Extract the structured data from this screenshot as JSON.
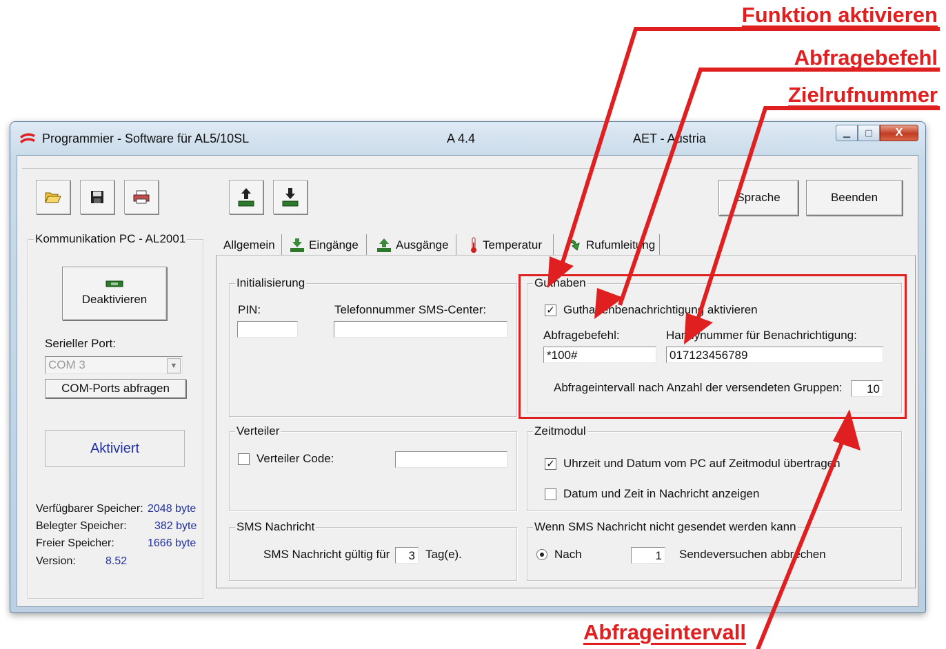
{
  "callouts": {
    "funktion": "Funktion aktivieren",
    "abfragebefehl": "Abfragebefehl",
    "zielrufnummer": "Zielrufnummer",
    "abfrageintervall": "Abfrageintervall"
  },
  "window": {
    "title": "Programmier - Software für AL5/10SL",
    "version": "A 4.4",
    "vendor": "AET - Austria",
    "minimize_icon": "minimize-icon",
    "maximize_icon": "maximize-icon",
    "close_label": "X"
  },
  "toolbar": {
    "open_icon": "folder-open-icon",
    "save_icon": "floppy-disk-icon",
    "print_icon": "printer-icon",
    "upload_icon": "upload-device-icon",
    "download_icon": "download-device-icon",
    "sprache_label": "Sprache",
    "beenden_label": "Beenden"
  },
  "left": {
    "group_title": "Kommunikation PC - AL2001",
    "deactivate_label": "Deaktivieren",
    "serial_port_label": "Serieller Port:",
    "com_value": "COM 3",
    "com_ports_button": "COM-Ports abfragen",
    "status": "Aktiviert",
    "memory": [
      {
        "label": "Verfügbarer Speicher:",
        "value": "2048 byte"
      },
      {
        "label": "Belegter Speicher:",
        "value": "382 byte"
      },
      {
        "label": "Freier Speicher:",
        "value": "1666 byte"
      },
      {
        "label": "Version:",
        "value": "8.52"
      }
    ]
  },
  "tabs": [
    {
      "label": "Allgemein"
    },
    {
      "label": "Eingänge"
    },
    {
      "label": "Ausgänge"
    },
    {
      "label": "Temperatur"
    },
    {
      "label": "Rufumleitung"
    }
  ],
  "init": {
    "title": "Initialisierung",
    "pin_label": "PIN:",
    "pin_value": "",
    "sms_center_label": "Telefonnummer SMS-Center:",
    "sms_center_value": ""
  },
  "guthaben": {
    "title": "Guthaben",
    "checkbox_label": "Guthabenbenachrichtigung aktivieren",
    "checked": true,
    "abfragebefehl_label": "Abfragebefehl:",
    "abfragebefehl_value": "*100#",
    "handy_label": "Handynummer für Benachrichtigung:",
    "handy_value": "017123456789",
    "interval_label": "Abfrageintervall nach Anzahl der versendeten Gruppen:",
    "interval_value": "10"
  },
  "verteiler": {
    "title": "Verteiler",
    "code_label": "Verteiler Code:",
    "checked": false,
    "code_value": ""
  },
  "zeitmodul": {
    "title": "Zeitmodul",
    "opt1_label": "Uhrzeit und Datum vom PC auf Zeitmodul übertragen",
    "opt1_checked": true,
    "opt2_label": "Datum und Zeit in Nachricht anzeigen",
    "opt2_checked": false
  },
  "sms": {
    "title": "SMS Nachricht",
    "valid_label": "SMS Nachricht gültig für",
    "valid_value": "3",
    "unit": "Tag(e)."
  },
  "fallback": {
    "title": "Wenn SMS Nachricht nicht gesendet werden kann",
    "radio_label": "Nach",
    "count_value": "1",
    "suffix": "Sendeversuchen abbrechen"
  },
  "colors": {
    "callout_red": "#e02020",
    "memory_blue": "#2230a0"
  }
}
